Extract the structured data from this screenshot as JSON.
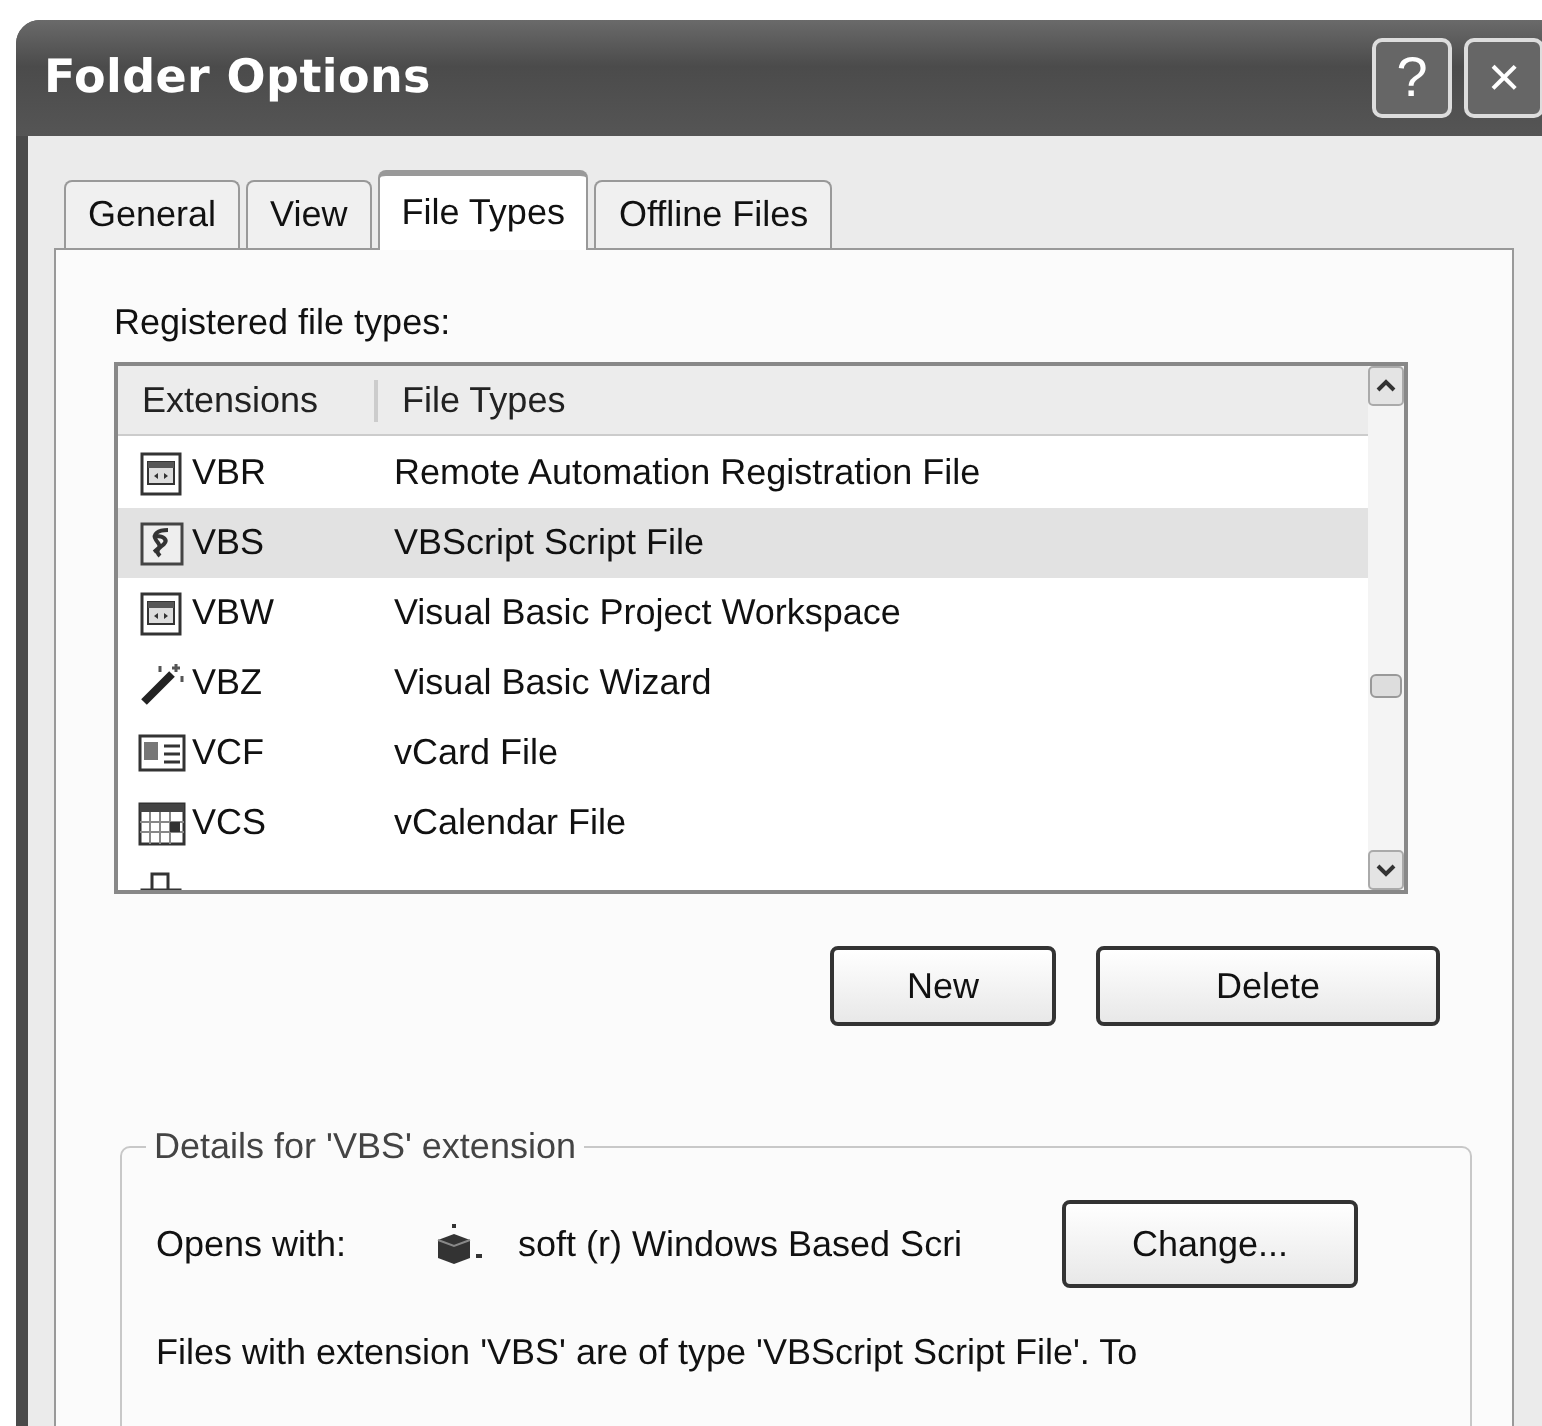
{
  "window": {
    "title": "Folder Options",
    "buttons": [
      "?",
      "×"
    ]
  },
  "tabs": [
    {
      "label": "General",
      "selected": false
    },
    {
      "label": "View",
      "selected": false
    },
    {
      "label": "File Types",
      "selected": true
    },
    {
      "label": "Offline Files",
      "selected": false
    }
  ],
  "registered_label": "Registered file types:",
  "table": {
    "columns": [
      "Extensions",
      "File Types"
    ],
    "rows": [
      {
        "kind": "app",
        "extension": "VBR",
        "file_type": "Remote Automation Registration File",
        "selected": false
      },
      {
        "kind": "script",
        "extension": "VBS",
        "file_type": "VBScript Script File",
        "selected": true
      },
      {
        "kind": "app",
        "extension": "VBW",
        "file_type": "Visual Basic Project Workspace",
        "selected": false
      },
      {
        "kind": "wand",
        "extension": "VBZ",
        "file_type": "Visual Basic Wizard",
        "selected": false
      },
      {
        "kind": "card",
        "extension": "VCF",
        "file_type": "vCard File",
        "selected": false
      },
      {
        "kind": "calendar",
        "extension": "VCS",
        "file_type": "vCalendar File",
        "selected": false
      },
      {
        "kind": "deploy",
        "selected": false
      }
    ]
  },
  "buttons": [
    "New",
    "Delete"
  ],
  "details": {
    "legend": "Details for 'VBS' extension",
    "opens_with_label": "Opens with:",
    "opens_with_value": "soft (r) Windows Based Scri",
    "change_button": "Change...",
    "description": "Files with extension 'VBS' are of type 'VBScript Script File'.  To"
  }
}
